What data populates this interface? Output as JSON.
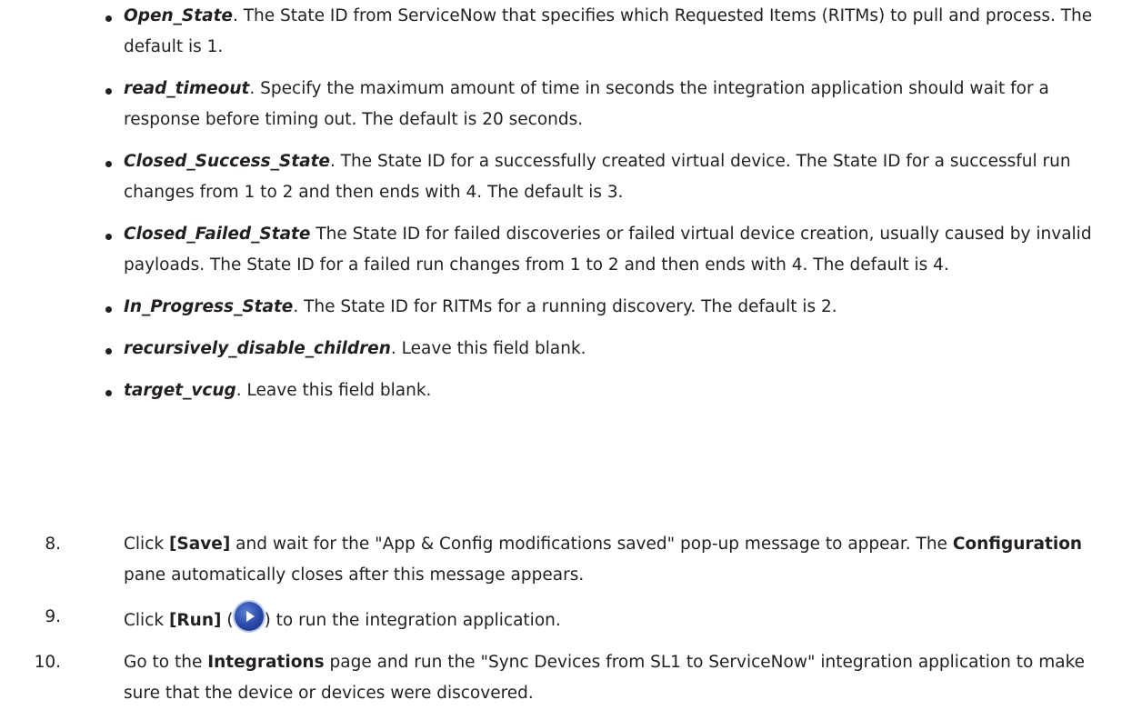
{
  "bullets": [
    {
      "term": "Open_State",
      "sep": ".",
      "text": " The State ID from ServiceNow that specifies which Requested Items (RITMs) to pull and process. The default is 1."
    },
    {
      "term": "read_timeout",
      "sep": ".",
      "text": " Specify the maximum amount of time in seconds the integration application should wait for a response before timing out. The default is 20 seconds."
    },
    {
      "term": "Closed_Success_State",
      "sep": ".",
      "text": " The State ID for a successfully created virtual device. The State ID for a successful run changes from 1 to 2 and then ends with 4. The default is 3."
    },
    {
      "term": "Closed_Failed_State",
      "sep": "",
      "text": " The State ID for failed discoveries or failed virtual device creation, usually caused by invalid payloads. The State ID for a failed run changes from 1 to 2 and then ends with 4. The default is 4."
    },
    {
      "term": "In_Progress_State",
      "sep": ".",
      "text": " The State ID for RITMs for a running discovery. The default is 2."
    },
    {
      "term": "recursively_disable_children",
      "sep": ".",
      "text": " Leave this field blank."
    },
    {
      "term": "target_vcug",
      "sep": ".",
      "text": " Leave this field blank."
    }
  ],
  "steps": {
    "s8": {
      "num": "8.",
      "click": "Click ",
      "save": "[Save]",
      "mid": " and wait for the \"App & Config modifications saved\" pop-up message to appear. The ",
      "pane": "Configuration",
      "end": " pane automatically closes after this message appears."
    },
    "s9": {
      "num": "9.",
      "click": "Click ",
      "run": "[Run]",
      "open_paren": " (",
      "close": ") to run the integration application.",
      "icon": "play-circle-icon"
    },
    "s10": {
      "num": "10.",
      "start": "Go to the ",
      "page": "Integrations",
      "end": " page and run the \"Sync Devices from SL1 to ServiceNow\" integration application to make sure that the device or devices were discovered."
    }
  }
}
